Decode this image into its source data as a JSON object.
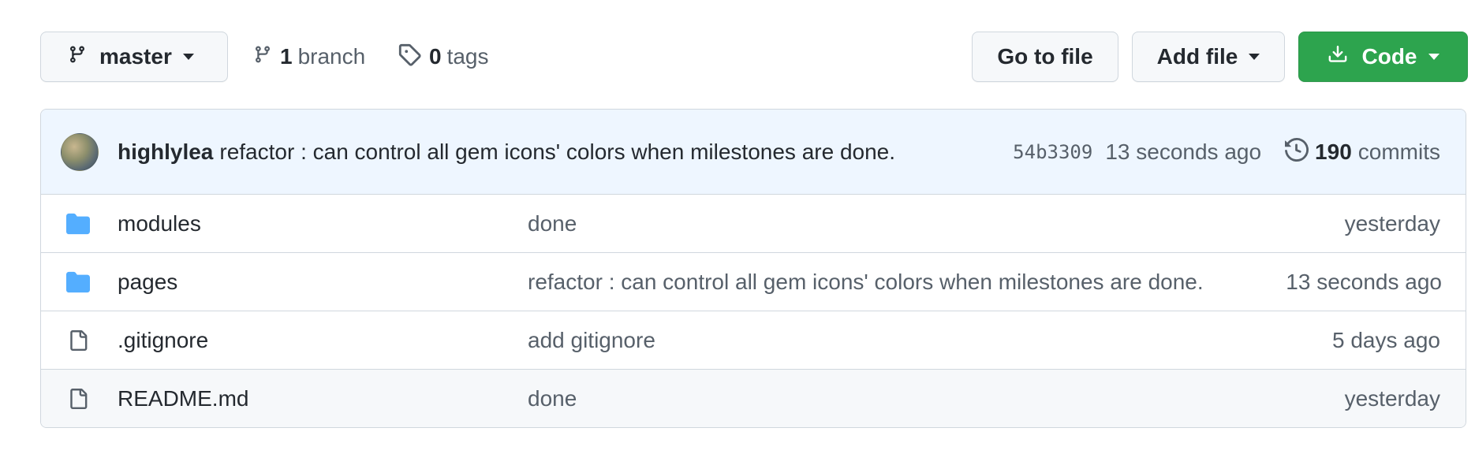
{
  "toolbar": {
    "branch_name": "master",
    "branches_count": "1",
    "branches_label": "branch",
    "tags_count": "0",
    "tags_label": "tags",
    "goto_label": "Go to file",
    "add_file_label": "Add file",
    "code_label": "Code"
  },
  "latest_commit": {
    "author": "highlylea",
    "message": "refactor : can control all gem icons' colors when milestones are done.",
    "sha": "54b3309",
    "time": "13 seconds ago",
    "commits_count": "190",
    "commits_label": "commits"
  },
  "files": [
    {
      "icon": "folder-icon",
      "name": "modules",
      "message": "done",
      "time": "yesterday"
    },
    {
      "icon": "folder-icon",
      "name": "pages",
      "message": "refactor : can control all gem icons' colors when milestones are done.",
      "time": "13 seconds ago"
    },
    {
      "icon": "file-icon",
      "name": ".gitignore",
      "message": "add gitignore",
      "time": "5 days ago"
    },
    {
      "icon": "file-icon",
      "name": "README.md",
      "message": "done",
      "time": "yesterday"
    }
  ],
  "colors": {
    "primary_button": "#2da44e",
    "folder_icon": "#54aeff",
    "commit_bar_bg": "#eef6ff",
    "muted_text": "#57606a"
  }
}
